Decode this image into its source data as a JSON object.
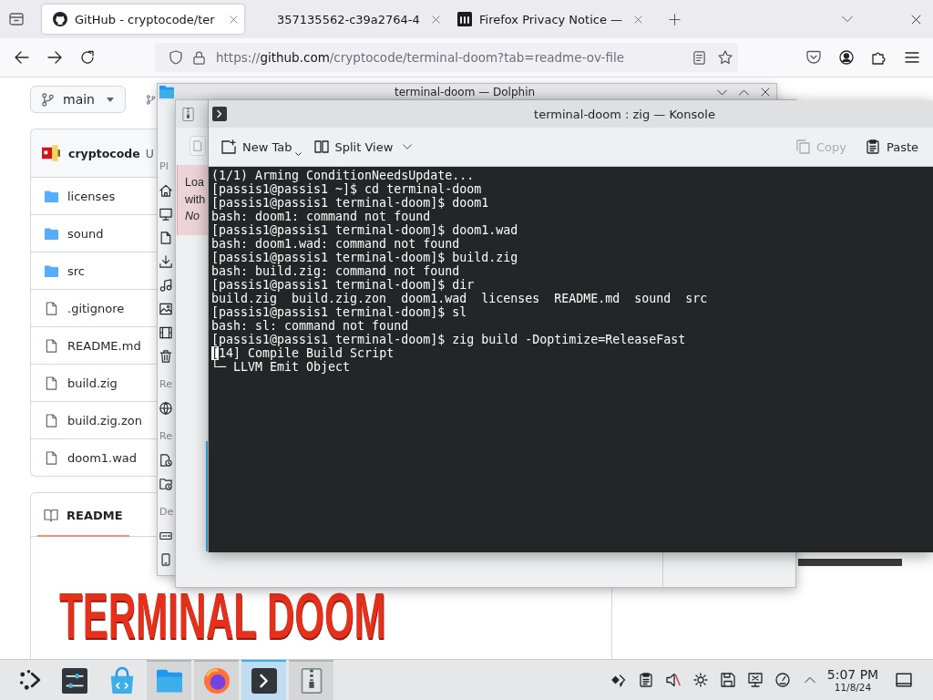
{
  "browser": {
    "tabs": [
      {
        "title": "GitHub - cryptocode/ter",
        "selected": true
      },
      {
        "title": "357135562-c39a2764-4",
        "selected": false
      },
      {
        "title": "Firefox Privacy Notice —",
        "selected": false
      }
    ],
    "url": "https://**github.com**/cryptocode/terminal-doom?tab=readme-ov-file"
  },
  "repo": {
    "branch": "main",
    "commit": {
      "author": "cryptocode",
      "message": "U"
    },
    "files": [
      {
        "name": "licenses",
        "kind": "folder"
      },
      {
        "name": "sound",
        "kind": "folder"
      },
      {
        "name": "src",
        "kind": "folder"
      },
      {
        "name": ".gitignore",
        "kind": "file"
      },
      {
        "name": "README.md",
        "kind": "file"
      },
      {
        "name": "build.zig",
        "kind": "file"
      },
      {
        "name": "build.zig.zon",
        "kind": "file"
      },
      {
        "name": "doom1.wad",
        "kind": "file"
      }
    ],
    "readme": {
      "tabs": [
        {
          "label": "README",
          "selected": true
        }
      ],
      "logo": "TERMINAL DOOM"
    }
  },
  "dolphin": {
    "title": "terminal-doom — Dolphin",
    "places": [
      {
        "heading": "Pl"
      },
      {
        "heading": "Re"
      },
      {
        "heading": "Re"
      },
      {
        "heading": "De"
      }
    ]
  },
  "ark": {
    "message": [
      "Loa",
      "with"
    ],
    "error": "No"
  },
  "konsole": {
    "title": "terminal-doom : zig — Konsole",
    "toolbar": {
      "left": [
        {
          "label": "New Tab",
          "kind": "split",
          "disabled": false
        },
        {
          "label": "Split View",
          "kind": "dropdown",
          "disabled": false
        }
      ],
      "right": [
        {
          "label": "Copy",
          "disabled": true
        },
        {
          "label": "Paste",
          "disabled": false
        }
      ]
    },
    "lines": [
      {
        "text": "(1/1) Arming ConditionNeedsUpdate...",
        "cursor": false
      },
      {
        "text": "[passis1@passis1 ~]$ cd terminal-doom",
        "cursor": false
      },
      {
        "text": "[passis1@passis1 terminal-doom]$ doom1",
        "cursor": false
      },
      {
        "text": "bash: doom1: command not found",
        "cursor": false
      },
      {
        "text": "[passis1@passis1 terminal-doom]$ doom1.wad",
        "cursor": false
      },
      {
        "text": "bash: doom1.wad: command not found",
        "cursor": false
      },
      {
        "text": "[passis1@passis1 terminal-doom]$ build.zig",
        "cursor": false
      },
      {
        "text": "bash: build.zig: command not found",
        "cursor": false
      },
      {
        "text": "[passis1@passis1 terminal-doom]$ dir",
        "cursor": false
      },
      {
        "text": "build.zig  build.zig.zon  doom1.wad  licenses  README.md  sound  src",
        "cursor": false
      },
      {
        "text": "[passis1@passis1 terminal-doom]$ sl",
        "cursor": false
      },
      {
        "text": "bash: sl: command not found",
        "cursor": false
      },
      {
        "text": "[passis1@passis1 terminal-doom]$ zig build -Doptimize=ReleaseFast",
        "cursor": false
      },
      {
        "text": "[14] Compile Build Script",
        "cursor": true
      },
      {
        "text": "└─ LLVM Emit Object",
        "cursor": false
      }
    ]
  },
  "taskbar": {
    "tasks": [
      {
        "running": false,
        "selected": false
      },
      {
        "running": false,
        "selected": false
      },
      {
        "running": true,
        "selected": false
      },
      {
        "running": true,
        "selected": false
      },
      {
        "running": true,
        "selected": true
      },
      {
        "running": true,
        "selected": false
      }
    ],
    "tray": {
      "volume_muted": true
    },
    "clock": {
      "time": "5:07 PM",
      "date": "11/8/24"
    }
  }
}
